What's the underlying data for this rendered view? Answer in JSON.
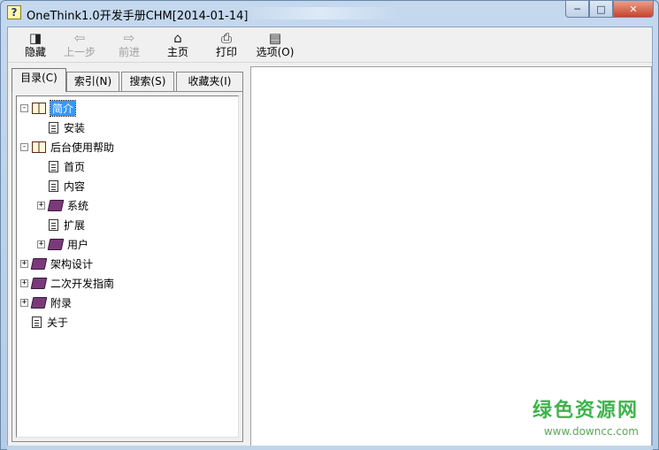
{
  "window": {
    "title": "OneThink1.0开发手册CHM[2014-01-14]",
    "controls": {
      "minimize": "─",
      "maximize": "□",
      "close": "✕"
    }
  },
  "toolbar": {
    "items": [
      {
        "label": "隐藏",
        "icon": "hide-icon",
        "glyph": "◨",
        "enabled": true
      },
      {
        "label": "上一步",
        "icon": "back-icon",
        "glyph": "⇦",
        "enabled": false
      },
      {
        "label": "前进",
        "icon": "forward-icon",
        "glyph": "⇨",
        "enabled": false
      },
      {
        "label": "主页",
        "icon": "home-icon",
        "glyph": "⌂",
        "enabled": true
      },
      {
        "label": "打印",
        "icon": "print-icon",
        "glyph": "⎙",
        "enabled": true
      },
      {
        "label": "选项(O)",
        "icon": "options-icon",
        "glyph": "▤",
        "enabled": true
      }
    ]
  },
  "tabs": [
    {
      "label": "目录(C)",
      "active": true
    },
    {
      "label": "索引(N)",
      "active": false
    },
    {
      "label": "搜索(S)",
      "active": false
    },
    {
      "label": "收藏夹(I)",
      "active": false
    }
  ],
  "tree": [
    {
      "label": "简介",
      "level": 0,
      "expander": "−",
      "icon": "book-open",
      "selected": true
    },
    {
      "label": "安装",
      "level": 1,
      "expander": "",
      "icon": "page",
      "selected": false
    },
    {
      "label": "后台使用帮助",
      "level": 0,
      "expander": "−",
      "icon": "book-open",
      "selected": false
    },
    {
      "label": "首页",
      "level": 1,
      "expander": "",
      "icon": "page",
      "selected": false
    },
    {
      "label": "内容",
      "level": 1,
      "expander": "",
      "icon": "page",
      "selected": false
    },
    {
      "label": "系统",
      "level": 1,
      "expander": "+",
      "icon": "book-closed",
      "selected": false
    },
    {
      "label": "扩展",
      "level": 1,
      "expander": "",
      "icon": "page",
      "selected": false
    },
    {
      "label": "用户",
      "level": 1,
      "expander": "+",
      "icon": "book-closed",
      "selected": false
    },
    {
      "label": "架构设计",
      "level": 0,
      "expander": "+",
      "icon": "book-closed",
      "selected": false
    },
    {
      "label": "二次开发指南",
      "level": 0,
      "expander": "+",
      "icon": "book-closed",
      "selected": false
    },
    {
      "label": "附录",
      "level": 0,
      "expander": "+",
      "icon": "book-closed",
      "selected": false
    },
    {
      "label": "关于",
      "level": 0,
      "expander": "",
      "icon": "page",
      "selected": false
    }
  ],
  "watermark": {
    "name": "绿色资源网",
    "url": "www.downcc.com"
  }
}
